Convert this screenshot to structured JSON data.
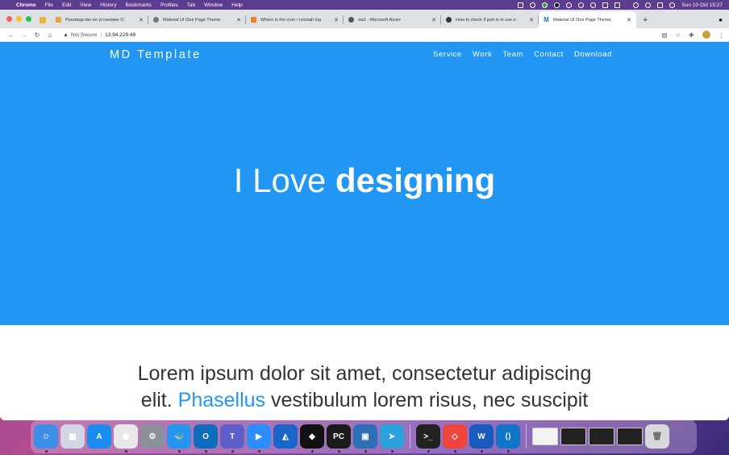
{
  "menubar": {
    "app": "Chrome",
    "items": [
      "File",
      "Edit",
      "View",
      "History",
      "Bookmarks",
      "Profiles",
      "Tab",
      "Window",
      "Help"
    ],
    "clock": "Sun 10 Oct 15:27"
  },
  "tabs": [
    {
      "title": "Руководство по установке O",
      "favicon_color": "#e8a23a",
      "active": false
    },
    {
      "title": "Material UI One Page Theme",
      "favicon_color": "#777777",
      "active": false
    },
    {
      "title": "Where is the cron / crontab log",
      "favicon_color": "#f48024",
      "active": false
    },
    {
      "title": "wa1 - Microsoft Azure",
      "favicon_color": "#555555",
      "active": false
    },
    {
      "title": "How to check if port is in use o",
      "favicon_color": "#333333",
      "active": false
    },
    {
      "title": "Material UI One Page Theme",
      "favicon_color": "#1976d2",
      "favicon_letter": "M",
      "active": true
    }
  ],
  "toolbar": {
    "security_label": "Not Secure",
    "url": "13.94.229.49"
  },
  "site": {
    "brand": "MD Template",
    "nav": [
      "Service",
      "Work",
      "Team",
      "Contact",
      "Download"
    ],
    "headline_light": "I Love ",
    "headline_bold": "designing",
    "intro_line1": "Lorem ipsum dolor sit amet, consectetur adipiscing",
    "intro_line2_before": "elit. ",
    "intro_accent": "Phasellus",
    "intro_line2_after": " vestibulum lorem risus, nec suscipit",
    "accent_color": "#2196f3"
  },
  "dock": {
    "apps": [
      {
        "name": "finder-icon",
        "color": "#3d8ee8",
        "glyph": "☺",
        "running": true
      },
      {
        "name": "launchpad-icon",
        "color": "#d0d6e6",
        "glyph": "▦",
        "running": false
      },
      {
        "name": "app-store-icon",
        "color": "#1a8cf0",
        "glyph": "A",
        "running": false
      },
      {
        "name": "chrome-icon",
        "color": "#e8e8e8",
        "glyph": "◉",
        "running": true
      },
      {
        "name": "system-preferences-icon",
        "color": "#8a8f99",
        "glyph": "⚙",
        "running": false
      },
      {
        "name": "docker-icon",
        "color": "#2496ed",
        "glyph": "🐳",
        "running": true
      },
      {
        "name": "outlook-icon",
        "color": "#0f6cbd",
        "glyph": "O",
        "running": true
      },
      {
        "name": "teams-icon",
        "color": "#5b5fc7",
        "glyph": "T",
        "running": true
      },
      {
        "name": "zoom-icon",
        "color": "#2d8cff",
        "glyph": "▶",
        "running": true
      },
      {
        "name": "wireshark-icon",
        "color": "#1a66c8",
        "glyph": "◭",
        "running": false
      },
      {
        "name": "tidal-icon",
        "color": "#111111",
        "glyph": "◆",
        "running": true
      },
      {
        "name": "pycharm-icon",
        "color": "#1b1b1b",
        "glyph": "PC",
        "running": true
      },
      {
        "name": "virtualbox-icon",
        "color": "#2c6fb8",
        "glyph": "▣",
        "running": true
      },
      {
        "name": "telegram-icon",
        "color": "#2aa1da",
        "glyph": "➤",
        "running": true
      }
    ],
    "apps2": [
      {
        "name": "terminal-icon",
        "color": "#222222",
        "glyph": ">_",
        "running": true
      },
      {
        "name": "anydesk-icon",
        "color": "#ef443b",
        "glyph": "◇",
        "running": true
      },
      {
        "name": "word-icon",
        "color": "#185abd",
        "glyph": "W",
        "running": true
      },
      {
        "name": "vscode-icon",
        "color": "#0e75c9",
        "glyph": "⟨⟩",
        "running": true
      }
    ],
    "thumbs": 4,
    "trash": "trash-icon"
  }
}
